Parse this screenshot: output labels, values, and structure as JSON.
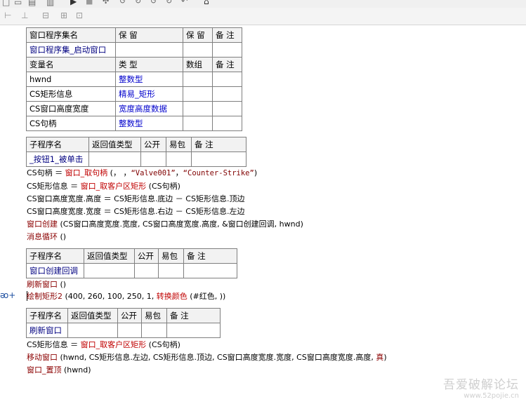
{
  "assembly_table": {
    "header": [
      "窗口程序集名",
      "保 留",
      "保 留",
      "备 注"
    ],
    "row": [
      "窗口程序集_启动窗口",
      "",
      "",
      ""
    ]
  },
  "vars_table": {
    "header": [
      "变量名",
      "类 型",
      "数组",
      "备 注"
    ],
    "rows": [
      [
        "hwnd",
        "整数型",
        "",
        ""
      ],
      [
        "CS矩形信息",
        "精易_矩形",
        "",
        ""
      ],
      [
        "CS窗口高度宽度",
        "宽度高度数据",
        "",
        ""
      ],
      [
        "CS句柄",
        "整数型",
        "",
        ""
      ]
    ]
  },
  "sub1": {
    "header": [
      "子程序名",
      "返回值类型",
      "公开",
      "易包",
      "备 注"
    ],
    "name": "_按钮1_被单击"
  },
  "code1": [
    {
      "a": "CS句柄 ＝ ",
      "f": "窗口_取句柄",
      "b": " (， ，",
      "s1": "“Valve001”",
      "c": "，",
      "s2": "“Counter-Strike”",
      "d": ")"
    },
    {
      "a": "CS矩形信息 ＝ ",
      "f": "窗口_取客户区矩形",
      "b": " (CS句柄)"
    },
    {
      "a": "CS窗口高度宽度.高度 ＝ CS矩形信息.底边 － CS矩形信息.顶边"
    },
    {
      "a": "CS窗口高度宽度.宽度 ＝ CS矩形信息.右边 － CS矩形信息.左边"
    },
    {
      "f": "窗口创建",
      "b": " (CS窗口高度宽度.宽度, CS窗口高度宽度.高度, &窗口创建回调, hwnd)"
    },
    {
      "f": "消息循环",
      "b": " ()"
    }
  ],
  "sub2": {
    "header": [
      "子程序名",
      "返回值类型",
      "公开",
      "易包",
      "备 注"
    ],
    "name": "窗口创建回调"
  },
  "code2": [
    {
      "f": "刷新窗口",
      "b": " ()"
    },
    {
      "f": "绘制矩形2",
      "b": " (400, 260, 100, 250, 1, ",
      "f2": "转换颜色",
      "c": " (#红色, ))"
    }
  ],
  "sub3": {
    "header": [
      "子程序名",
      "返回值类型",
      "公开",
      "易包",
      "备 注"
    ],
    "name": "刷新窗口"
  },
  "code3": [
    {
      "a": "CS矩形信息 ＝ ",
      "f": "窗口_取客户区矩形",
      "b": " (CS句柄)"
    },
    {
      "f": "移动窗口",
      "b": " (hwnd, CS矩形信息.左边, CS矩形信息.顶边, CS窗口高度宽度.宽度, CS窗口高度宽度.高度, ",
      "k": "真",
      "c": ")"
    },
    {
      "f": "窗口_置顶",
      "b": " (hwnd)"
    }
  ],
  "gutter": {
    "marker": "ᴔ+"
  },
  "watermark": {
    "line1": "吾爱破解论坛",
    "line2": "www.52pojie.cn"
  }
}
